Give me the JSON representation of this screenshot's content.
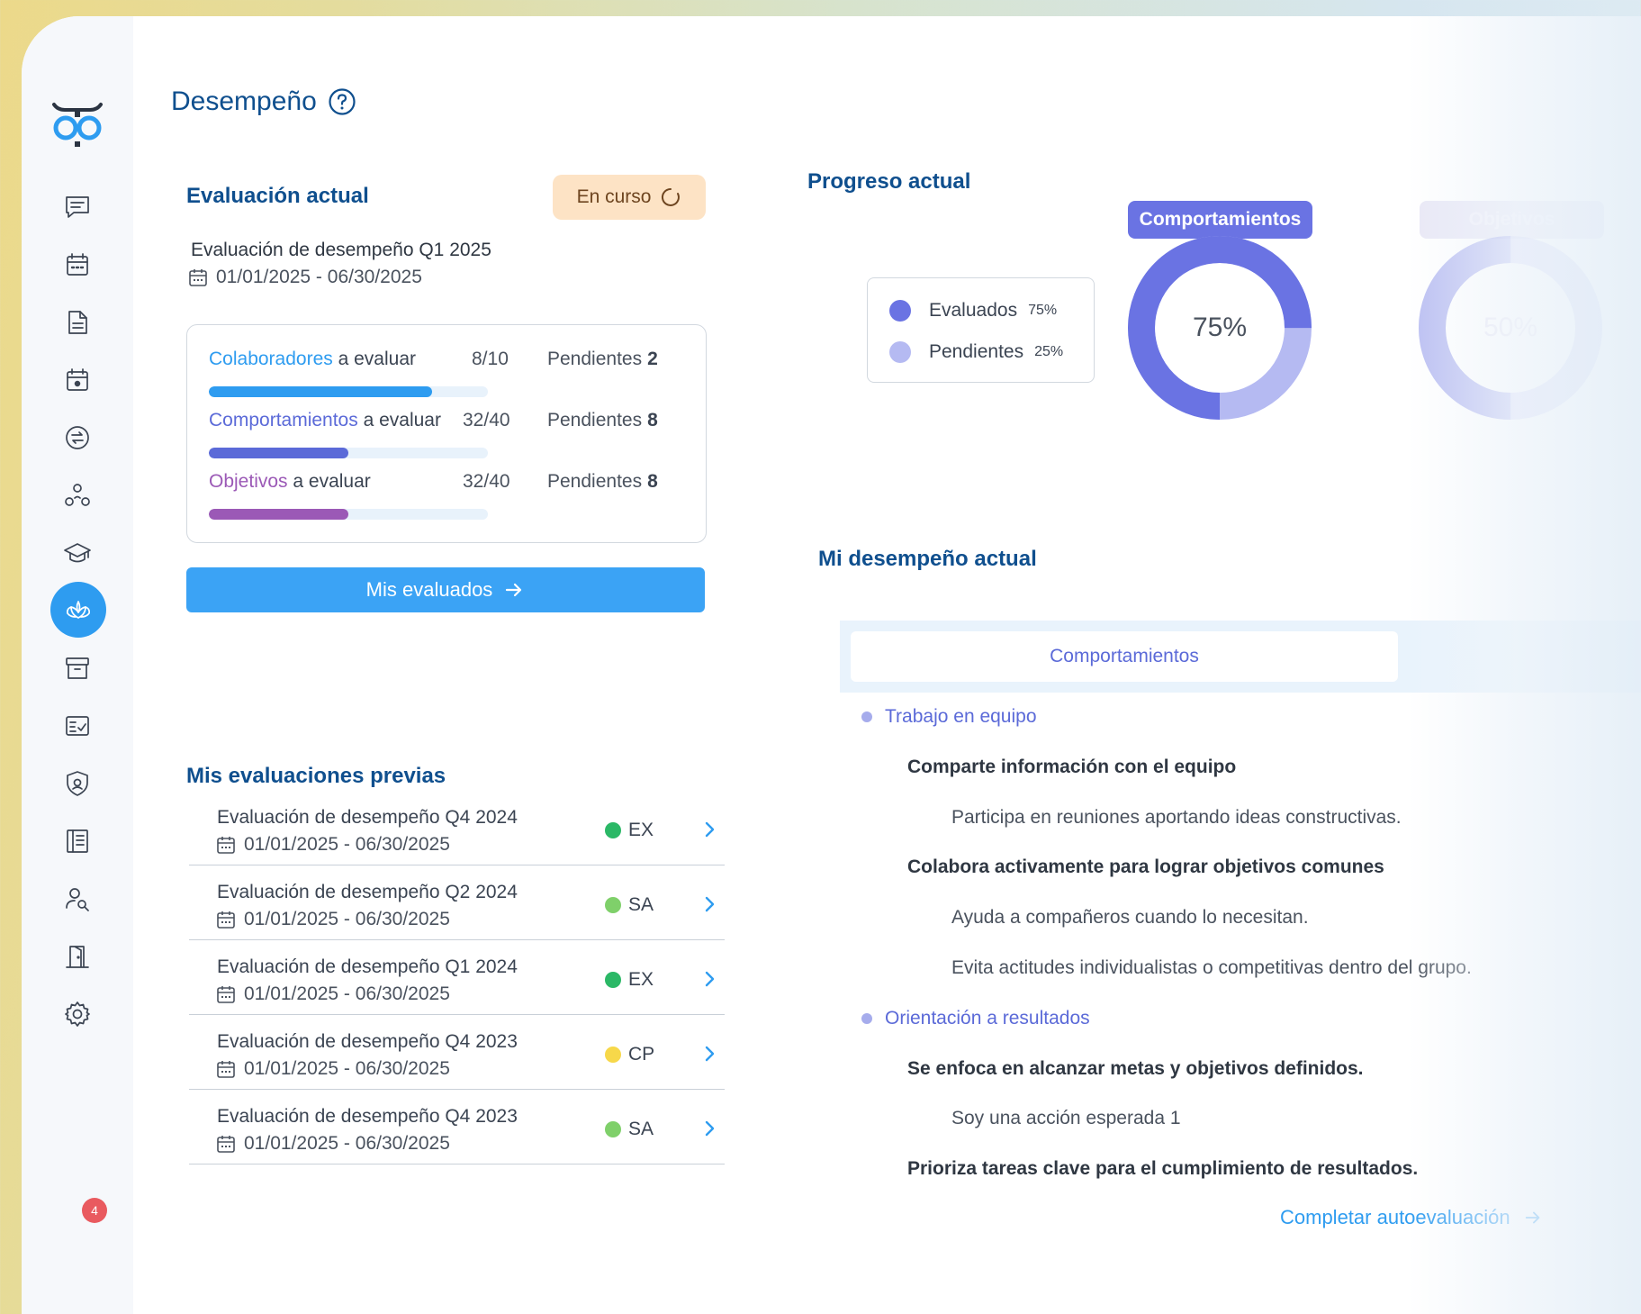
{
  "page": {
    "title": "Desempeño"
  },
  "current_eval": {
    "heading": "Evaluación actual",
    "status": "En curso",
    "name": "Evaluación de desempeño Q1 2025",
    "dates": "01/01/2025 - 06/30/2025",
    "stats": [
      {
        "highlight": "Colaboradores",
        "rest": " a evaluar",
        "count": "8/10",
        "pending_label": "Pendientes",
        "pending": "2",
        "progress": 0.8,
        "color": "#2e9cf0"
      },
      {
        "highlight": "Comportamientos",
        "rest": " a evaluar",
        "count": "32/40",
        "pending_label": "Pendientes",
        "pending": "8",
        "progress": 0.5,
        "color": "#5b6ad8"
      },
      {
        "highlight": "Objetivos",
        "rest": " a evaluar",
        "count": "32/40",
        "pending_label": "Pendientes",
        "pending": "8",
        "progress": 0.5,
        "color": "#9b59b6"
      }
    ],
    "button": "Mis evaluados"
  },
  "previous": {
    "heading": "Mis evaluaciones previas",
    "items": [
      {
        "name": "Evaluación de desempeño Q4 2024",
        "dates": "01/01/2025 - 06/30/2025",
        "tag": "EX",
        "tag_color": "#2bb866"
      },
      {
        "name": "Evaluación de desempeño Q2 2024",
        "dates": "01/01/2025 - 06/30/2025",
        "tag": "SA",
        "tag_color": "#7fd06a"
      },
      {
        "name": "Evaluación de desempeño Q1 2024",
        "dates": "01/01/2025 - 06/30/2025",
        "tag": "EX",
        "tag_color": "#2bb866"
      },
      {
        "name": "Evaluación de desempeño Q4 2023",
        "dates": "01/01/2025 - 06/30/2025",
        "tag": "CP",
        "tag_color": "#f7d84a"
      },
      {
        "name": "Evaluación de desempeño Q4 2023",
        "dates": "01/01/2025 - 06/30/2025",
        "tag": "SA",
        "tag_color": "#7fd06a"
      }
    ]
  },
  "progress": {
    "heading": "Progreso actual",
    "legend": [
      {
        "label": "Evaluados",
        "value": "75%",
        "color": "#6a73e3"
      },
      {
        "label": "Pendientes",
        "value": "25%",
        "color": "#b5baf2"
      }
    ],
    "tabs": [
      {
        "label": "Comportamientos",
        "percent_label": "75%",
        "percent": 75
      },
      {
        "label": "Objetivos",
        "percent_label": "50%",
        "percent": 50
      }
    ]
  },
  "my_performance": {
    "heading": "Mi desempeño actual",
    "tab": "Comportamientos",
    "lines": [
      {
        "type": "cat",
        "text": "Trabajo en equipo"
      },
      {
        "type": "behav",
        "text": "Comparte información con el equipo"
      },
      {
        "type": "action",
        "text": "Participa en reuniones aportando ideas constructivas."
      },
      {
        "type": "behav",
        "text": "Colabora activamente para lograr objetivos comunes"
      },
      {
        "type": "action",
        "text": "Ayuda a compañeros cuando lo necesitan."
      },
      {
        "type": "action",
        "text": "Evita actitudes individualistas o competitivas dentro del grupo."
      },
      {
        "type": "cat",
        "text": "Orientación a resultados"
      },
      {
        "type": "behav",
        "text": "Se enfoca en alcanzar metas y objetivos definidos."
      },
      {
        "type": "action",
        "text": "Soy una acción esperada 1"
      },
      {
        "type": "behav",
        "text": "Prioriza tareas clave para el cumplimiento de resultados."
      }
    ],
    "cta": "Completar autoevaluación"
  },
  "sidebar": {
    "icons": [
      "chat-icon",
      "calendar-icon",
      "document-icon",
      "event-icon",
      "exchange-icon",
      "team-icon",
      "graduation-icon",
      "lotus-icon",
      "archive-icon",
      "checklist-icon",
      "shield-icon",
      "book-icon",
      "user-search-icon",
      "door-icon",
      "gear-icon"
    ],
    "active": "lotus-icon",
    "badge": "4"
  }
}
